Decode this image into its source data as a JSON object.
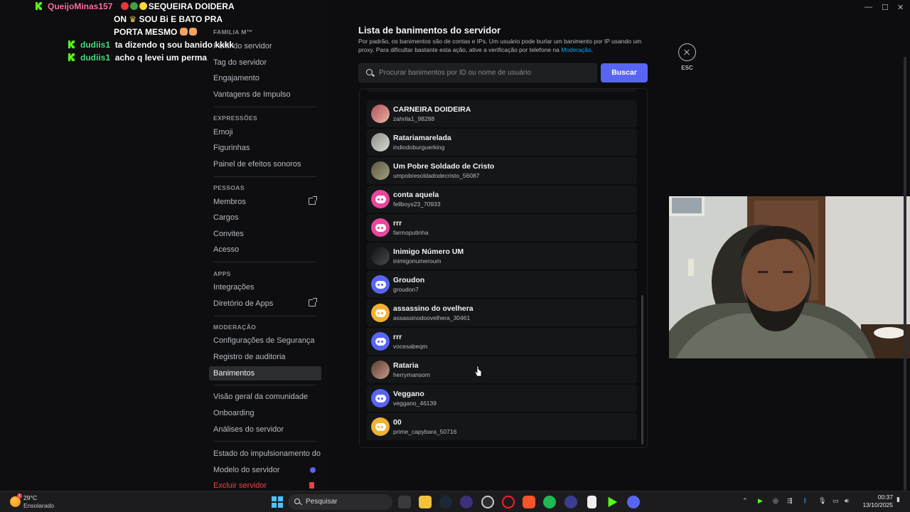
{
  "chat": {
    "line1_user": "QueijoMinas157",
    "line1_text_a": "SEQUEIRA DOIDERA",
    "line1_text_b": "ON",
    "line1_text_c": "SOU Bi E BATO PRA",
    "line1_text_d": "PORTA MESMO",
    "line2_user": "dudiis1",
    "line2_text": "ta dizendo q sou banido kkkk",
    "line3_user": "dudiis1",
    "line3_text": "acho q levei um perma"
  },
  "sidebar": {
    "cat_server": "FAMILIA M™",
    "item_profile": "Perfil do servidor",
    "item_tag": "Tag do servidor",
    "item_engagement": "Engajamento",
    "item_boost": "Vantagens de Impulso",
    "cat_expressions": "EXPRESSÕES",
    "item_emoji": "Emoji",
    "item_stickers": "Figurinhas",
    "item_soundboard": "Painel de efeitos sonoros",
    "cat_people": "PESSOAS",
    "item_members": "Membros",
    "item_roles": "Cargos",
    "item_invites": "Convites",
    "item_access": "Acesso",
    "cat_apps": "APPS",
    "item_integrations": "Integrações",
    "item_app_dir": "Diretório de Apps",
    "cat_moderation": "MODERAÇÃO",
    "item_safety": "Configurações de Segurança",
    "item_audit": "Registro de auditoria",
    "item_bans": "Banimentos",
    "item_community": "Visão geral da comunidade",
    "item_onboarding": "Onboarding",
    "item_analytics": "Análises do servidor",
    "item_boost_status": "Estado do impulsionamento do servidor",
    "item_template": "Modelo do servidor",
    "item_delete": "Excluir servidor"
  },
  "bans": {
    "title": "Lista de banimentos do servidor",
    "description": "Por padrão, os banimentos são de contas e IPs. Um usuário pode burlar um banimento por IP usando um proxy. Para dificultar bastante esta ação, ative a verificação por telefone na ",
    "description_link": "Moderação",
    "description_end": ".",
    "search_placeholder": "Procurar banimentos por ID ou nome de usuário",
    "search_button": "Buscar",
    "close_label": "ESC",
    "rows": [
      {
        "name": "CARNEIRA DOIDEIRA",
        "handle": "zahrila1_98288",
        "avatar": "photo-pink"
      },
      {
        "name": "Ratariamarelada",
        "handle": "indiodoburguerking",
        "avatar": "photo-gray"
      },
      {
        "name": "Um Pobre Soldado de Cristo",
        "handle": "umpobresoldadodecristo_56087",
        "avatar": "photo-olive"
      },
      {
        "name": "conta aquela",
        "handle": "fellboys23_70933",
        "avatar": "discord-pink"
      },
      {
        "name": "rrr",
        "handle": "farmoputinha",
        "avatar": "discord-pink"
      },
      {
        "name": "Inimigo Número UM",
        "handle": "inimigonumeroum",
        "avatar": "photo-dark"
      },
      {
        "name": "Groudon",
        "handle": "groudon7",
        "avatar": "discord-blurple"
      },
      {
        "name": "assassino do ovelhera",
        "handle": "assassinodoovelhera_30461",
        "avatar": "discord-yellow"
      },
      {
        "name": "rrr",
        "handle": "vocesabeqm",
        "avatar": "discord-blurple"
      },
      {
        "name": "Rataria",
        "handle": "herrymansom",
        "avatar": "photo-brown"
      },
      {
        "name": "Veggano",
        "handle": "veggano_46139",
        "avatar": "discord-blurple"
      },
      {
        "name": "00",
        "handle": "prime_capybara_50716",
        "avatar": "discord-yellow"
      }
    ]
  },
  "taskbar": {
    "temp": "29°C",
    "weather": "Ensolarado",
    "weather_badge": "1",
    "search_label": "Pesquisar",
    "time": "00:37",
    "date": "13/10/2025"
  },
  "colors": {
    "blurple": "#5865f2",
    "discord_pink": "#eb459e",
    "discord_yellow": "#f0b232",
    "danger": "#f23f43",
    "kick_green": "#53fc18"
  }
}
